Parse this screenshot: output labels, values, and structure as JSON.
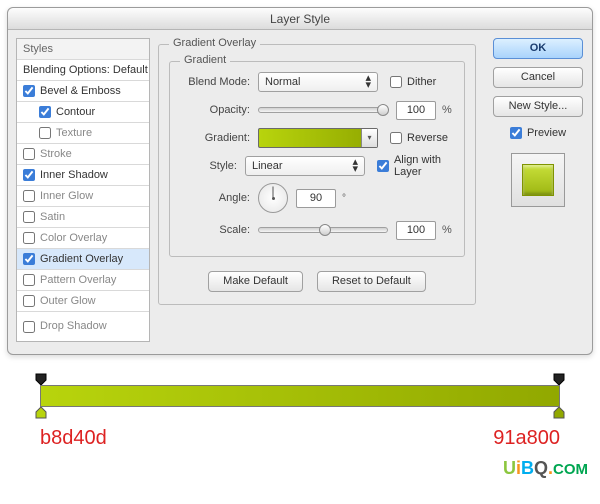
{
  "window": {
    "title": "Layer Style"
  },
  "sidebar": {
    "header": "Styles",
    "blending": "Blending Options: Default",
    "items": [
      {
        "label": "Bevel & Emboss",
        "checked": true,
        "indent": false
      },
      {
        "label": "Contour",
        "checked": true,
        "indent": true
      },
      {
        "label": "Texture",
        "checked": false,
        "indent": true
      },
      {
        "label": "Stroke",
        "checked": false,
        "indent": false
      },
      {
        "label": "Inner Shadow",
        "checked": true,
        "indent": false
      },
      {
        "label": "Inner Glow",
        "checked": false,
        "indent": false
      },
      {
        "label": "Satin",
        "checked": false,
        "indent": false
      },
      {
        "label": "Color Overlay",
        "checked": false,
        "indent": false
      },
      {
        "label": "Gradient Overlay",
        "checked": true,
        "indent": false,
        "selected": true
      },
      {
        "label": "Pattern Overlay",
        "checked": false,
        "indent": false
      },
      {
        "label": "Outer Glow",
        "checked": false,
        "indent": false
      },
      {
        "label": "Drop Shadow",
        "checked": false,
        "indent": false
      }
    ]
  },
  "panel": {
    "group_title": "Gradient Overlay",
    "subgroup_title": "Gradient",
    "blend_mode_label": "Blend Mode:",
    "blend_mode_value": "Normal",
    "dither_label": "Dither",
    "dither_checked": false,
    "opacity_label": "Opacity:",
    "opacity_value": "100",
    "opacity_unit": "%",
    "gradient_label": "Gradient:",
    "reverse_label": "Reverse",
    "reverse_checked": false,
    "style_label": "Style:",
    "style_value": "Linear",
    "align_label": "Align with Layer",
    "align_checked": true,
    "angle_label": "Angle:",
    "angle_value": "90",
    "angle_unit": "°",
    "scale_label": "Scale:",
    "scale_value": "100",
    "scale_unit": "%",
    "make_default": "Make Default",
    "reset_default": "Reset to Default"
  },
  "right": {
    "ok": "OK",
    "cancel": "Cancel",
    "new_style": "New Style...",
    "preview_label": "Preview",
    "preview_checked": true
  },
  "gradient_stops": {
    "left_hex": "b8d40d",
    "right_hex": "91a800"
  },
  "watermark": {
    "text": "UiBQ.CoM"
  }
}
